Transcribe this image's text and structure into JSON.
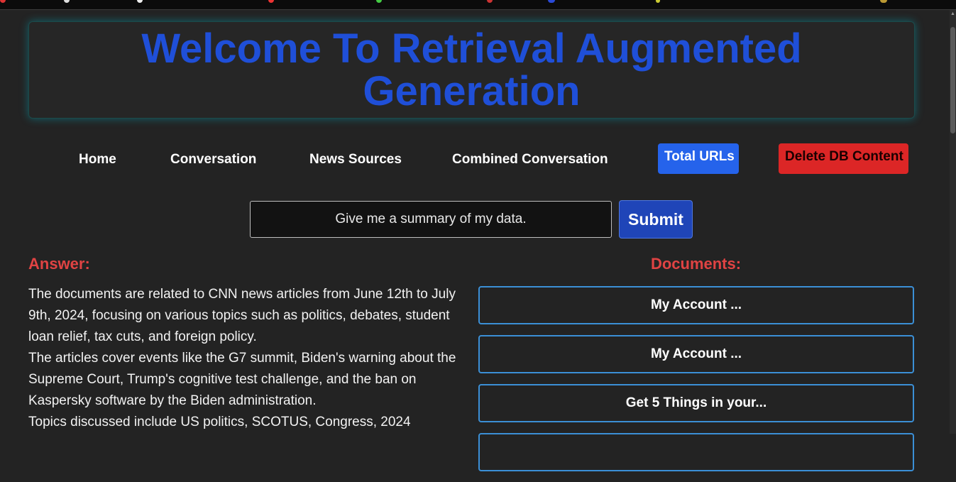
{
  "header": {
    "title": "Welcome To Retrieval Augmented Generation"
  },
  "nav": {
    "home": "Home",
    "conversation": "Conversation",
    "news_sources": "News Sources",
    "combined_conversation": "Combined Conversation",
    "total_urls": "Total URLs",
    "delete_db": "Delete DB Content"
  },
  "query": {
    "value": "Give me a summary of my data.",
    "submit_label": "Submit"
  },
  "answer": {
    "title": "Answer:",
    "paragraphs": [
      "The documents are related to CNN news articles from June 12th to July 9th, 2024, focusing on various topics such as politics, debates, student loan relief, tax cuts, and foreign policy.",
      "The articles cover events like the G7 summit, Biden's warning about the Supreme Court, Trump's cognitive test challenge, and the ban on Kaspersky software by the Biden administration.",
      "Topics discussed include US politics, SCOTUS, Congress, 2024"
    ]
  },
  "documents": {
    "title": "Documents:",
    "items": [
      "My Account ...",
      "My Account ...",
      "Get 5 Things in your..."
    ]
  },
  "colors": {
    "background": "#232323",
    "title_blue": "#1f4fd8",
    "accent_blue": "#2563eb",
    "danger_red": "#dc2626",
    "heading_red": "#e04343",
    "doc_border": "#3b8fd6"
  }
}
